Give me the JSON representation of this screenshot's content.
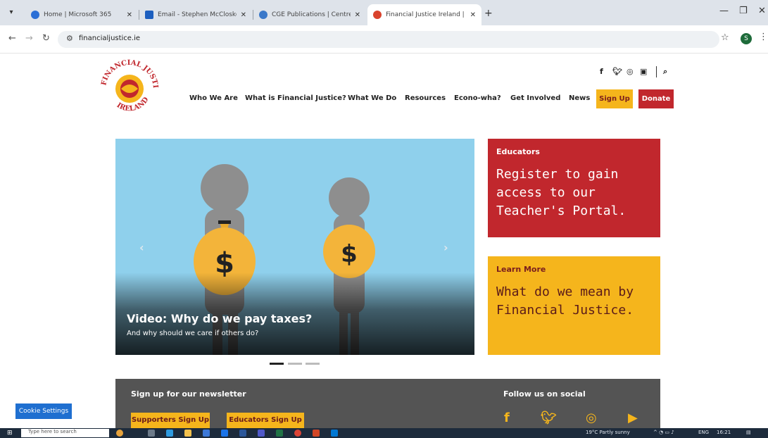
{
  "browser": {
    "tabs": [
      {
        "title": "Home | Microsoft 365",
        "favicon_color": "#2b6fd6"
      },
      {
        "title": "Email - Stephen McCloskey - O",
        "favicon_color": "#1d5fbf"
      },
      {
        "title": "CGE Publications | Centre for G",
        "favicon_color": "#3a78c9"
      },
      {
        "title": "Financial Justice Ireland | Home",
        "favicon_color": "#d9432d"
      }
    ],
    "address": "financialjustice.ie",
    "profile_initial": "S"
  },
  "site": {
    "logo": {
      "text_top": "FINANCIAL JUSTICE",
      "text_bottom": "IRELAND",
      "color": "#c1272d"
    },
    "nav": [
      "Who We Are",
      "What is Financial Justice?",
      "What We Do",
      "Resources",
      "Econo-wha?",
      "Get Involved",
      "News"
    ],
    "signup_label": "Sign Up",
    "donate_label": "Donate",
    "hero": {
      "title": "Video: Why do we pay taxes?",
      "subtitle": "And why should we care if others do?",
      "money_symbol": "$"
    },
    "educators_card": {
      "tag": "Educators",
      "text": "Register to gain access to our Teacher's Portal."
    },
    "learn_card": {
      "tag": "Learn More",
      "text": "What do we mean by Financial Justice."
    },
    "newsletter": {
      "heading": "Sign up for our newsletter",
      "supporters_label": "Supporters Sign Up",
      "educators_label": "Educators Sign Up"
    },
    "follow_heading": "Follow us on social",
    "cookie_label": "Cookie Settings"
  },
  "taskbar": {
    "search_placeholder": "Type here to search",
    "weather": "19°C Partly sunny",
    "lang": "ENG",
    "time": "16:21"
  },
  "colors": {
    "brand_red": "#c1272d",
    "brand_yellow": "#f5b51c",
    "hero_sky": "#8fd0ec",
    "band_grey": "#545454"
  }
}
